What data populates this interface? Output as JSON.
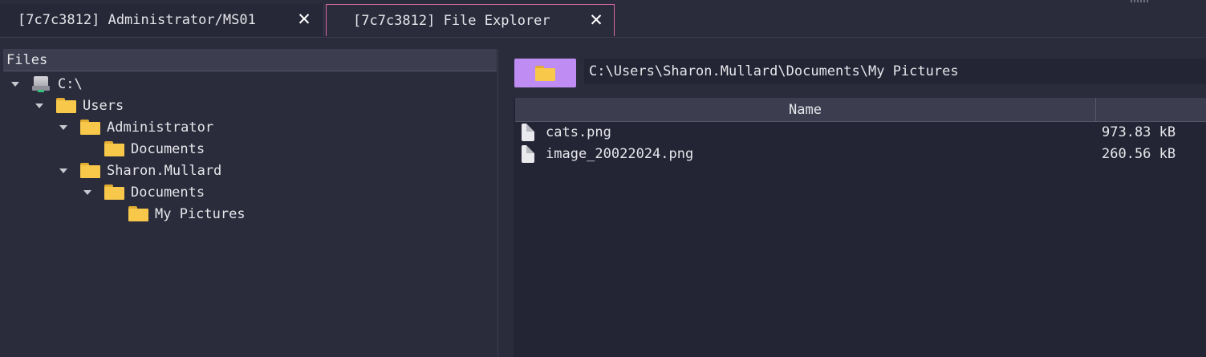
{
  "tabs": [
    {
      "label": "[7c7c3812] Administrator/MS01",
      "close": "✕"
    },
    {
      "label": "[7c7c3812] File Explorer",
      "close": "✕"
    }
  ],
  "tree": {
    "header": "Files",
    "nodes": [
      {
        "label": "C:\\",
        "icon": "drive-icon",
        "expanded": true
      },
      {
        "label": "Users",
        "icon": "folder-icon",
        "expanded": true
      },
      {
        "label": "Administrator",
        "icon": "folder-icon",
        "expanded": true
      },
      {
        "label": "Documents",
        "icon": "folder-icon",
        "expanded": false
      },
      {
        "label": "Sharon.Mullard",
        "icon": "folder-icon",
        "expanded": true
      },
      {
        "label": "Documents",
        "icon": "folder-icon",
        "expanded": true
      },
      {
        "label": "My Pictures",
        "icon": "folder-icon",
        "expanded": false
      }
    ]
  },
  "path_bar": {
    "path": "C:\\Users\\Sharon.Mullard\\Documents\\My Pictures",
    "button_icon": "folder-icon"
  },
  "file_list": {
    "columns": [
      "Name",
      ""
    ],
    "rows": [
      {
        "name": "cats.png",
        "size": "973.83 kB",
        "icon": "file-icon"
      },
      {
        "name": "image_20022024.png",
        "size": "260.56 kB",
        "icon": "file-icon"
      }
    ]
  },
  "colors": {
    "background": "#2a2b3b",
    "active_tab_border": "#d96aa4",
    "path_button": "#bf8cf3",
    "folder": "#f8c84a"
  }
}
